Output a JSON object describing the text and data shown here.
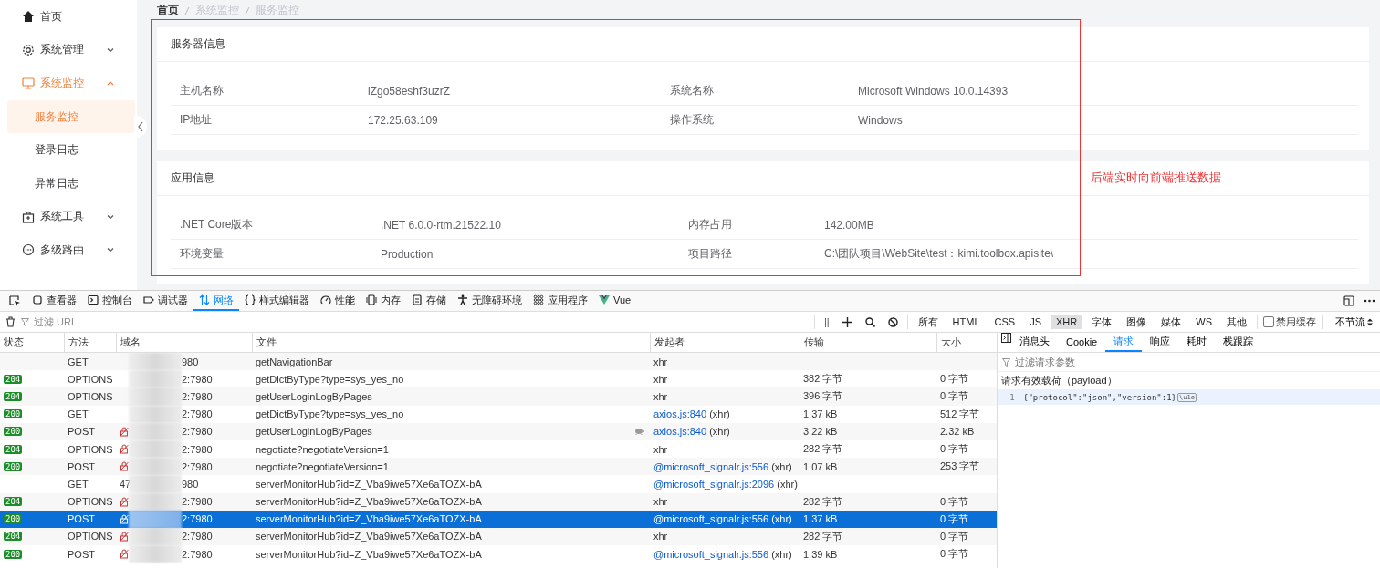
{
  "sidebar": {
    "items": [
      {
        "kind": "link",
        "label": "首页",
        "selected": false
      },
      {
        "kind": "menu",
        "label": "系统管理",
        "selected": false,
        "expanded": false
      },
      {
        "kind": "menu",
        "label": "系统监控",
        "selected": true,
        "expanded": true,
        "children": [
          {
            "label": "服务监控",
            "selected": true
          },
          {
            "label": "登录日志",
            "selected": false
          },
          {
            "label": "异常日志",
            "selected": false
          }
        ]
      },
      {
        "kind": "menu",
        "label": "系统工具",
        "selected": false,
        "expanded": false
      },
      {
        "kind": "menu",
        "label": "多级路由",
        "selected": false,
        "expanded": false
      }
    ]
  },
  "breadcrumb": [
    {
      "label": "首页",
      "link": true
    },
    {
      "label": "系统监控",
      "link": false
    },
    {
      "label": "服务监控",
      "link": false
    }
  ],
  "cards": [
    {
      "title": "服务器信息",
      "rows": [
        [
          "主机名称",
          "iZgo58eshf3uzrZ",
          "系统名称",
          "Microsoft Windows 10.0.14393"
        ],
        [
          "IP地址",
          "172.25.63.109",
          "操作系统",
          "Windows"
        ]
      ]
    },
    {
      "title": "应用信息",
      "rows": [
        [
          ".NET Core版本",
          ".NET 6.0.0-rtm.21522.10",
          "内存占用",
          "142.00MB"
        ],
        [
          "环境变量",
          "Production",
          "项目路径",
          "C:\\团队项目\\WebSite\\test：kimi.toolbox.apisite\\"
        ]
      ]
    }
  ],
  "annotation": {
    "text": "后端实时向前端推送数据"
  },
  "devtools": {
    "tabs": [
      {
        "label": "查看器",
        "selected": false
      },
      {
        "label": "控制台",
        "selected": false
      },
      {
        "label": "调试器",
        "selected": false
      },
      {
        "label": "网络",
        "selected": true
      },
      {
        "label": "样式编辑器",
        "selected": false
      },
      {
        "label": "性能",
        "selected": false
      },
      {
        "label": "内存",
        "selected": false
      },
      {
        "label": "存储",
        "selected": false
      },
      {
        "label": "无障碍环境",
        "selected": false
      },
      {
        "label": "应用程序",
        "selected": false
      },
      {
        "label": "Vue",
        "selected": false
      }
    ],
    "filter": {
      "placeholder": "过滤 URL"
    },
    "pause": "||",
    "type_filters": [
      {
        "label": "所有",
        "selected": false
      },
      {
        "label": "HTML",
        "selected": false
      },
      {
        "label": "CSS",
        "selected": false
      },
      {
        "label": "JS",
        "selected": false
      },
      {
        "label": "XHR",
        "selected": true
      },
      {
        "label": "字体",
        "selected": false
      },
      {
        "label": "图像",
        "selected": false
      },
      {
        "label": "媒体",
        "selected": false
      },
      {
        "label": "WS",
        "selected": false
      },
      {
        "label": "其他",
        "selected": false
      }
    ],
    "disable_cache": {
      "label": "禁用缓存",
      "checked": false
    },
    "throttle": "不节流",
    "columns": [
      "状态",
      "方法",
      "域名",
      "文件",
      "发起者",
      "传输",
      "大小"
    ],
    "requests": [
      {
        "method": "GET",
        "domain_end": "980",
        "insecure": false,
        "file": "getNavigationBar",
        "slow": false,
        "initiator": "xhr",
        "selected": false
      },
      {
        "status": "204",
        "method": "OPTIONS",
        "domain_end": "2:7980",
        "insecure": false,
        "file": "getDictByType?type=sys_yes_no",
        "slow": false,
        "initiator": "xhr",
        "transfer": "382 字节",
        "size": "0 字节",
        "selected": false
      },
      {
        "status": "204",
        "method": "OPTIONS",
        "domain_end": "2:7980",
        "insecure": false,
        "file": "getUserLoginLogByPages",
        "slow": false,
        "initiator": "xhr",
        "transfer": "396 字节",
        "size": "0 字节",
        "selected": false
      },
      {
        "status": "200",
        "method": "GET",
        "domain_end": "2:7980",
        "insecure": false,
        "file": "getDictByType?type=sys_yes_no",
        "slow": false,
        "initiator_link": "axios.js:840",
        "initiator": "(xhr)",
        "transfer": "1.37 kB",
        "size": "512 字节",
        "selected": false
      },
      {
        "status": "200",
        "method": "POST",
        "domain_end": "2:7980",
        "insecure": true,
        "file": "getUserLoginLogByPages",
        "slow": true,
        "initiator_link": "axios.js:840",
        "initiator": "(xhr)",
        "transfer": "3.22 kB",
        "size": "2.32 kB",
        "selected": false
      },
      {
        "status": "204",
        "method": "OPTIONS",
        "domain_end": "2:7980",
        "insecure": true,
        "file": "negotiate?negotiateVersion=1",
        "slow": false,
        "initiator": "xhr",
        "transfer": "282 字节",
        "size": "0 字节",
        "selected": false
      },
      {
        "status": "200",
        "method": "POST",
        "domain_end": "2:7980",
        "insecure": true,
        "file": "negotiate?negotiateVersion=1",
        "slow": false,
        "initiator_link": "@microsoft_signalr.js:556",
        "initiator": "(xhr)",
        "transfer": "1.07 kB",
        "size": "253 字节",
        "selected": false
      },
      {
        "method": "GET",
        "domain_start": "47",
        "domain_end": "980",
        "insecure": false,
        "file": "serverMonitorHub?id=Z_Vba9iwe57Xe6aTOZX-bA",
        "slow": false,
        "initiator_link": "@microsoft_signalr.js:2096",
        "initiator": "(xhr)",
        "selected": false
      },
      {
        "status": "204",
        "method": "OPTIONS",
        "domain_end": "2:7980",
        "insecure": true,
        "file": "serverMonitorHub?id=Z_Vba9iwe57Xe6aTOZX-bA",
        "slow": false,
        "initiator": "xhr",
        "transfer": "282 字节",
        "size": "0 字节",
        "selected": false
      },
      {
        "status": "200",
        "method": "POST",
        "domain_end": "2:7980",
        "insecure": true,
        "file": "serverMonitorHub?id=Z_Vba9iwe57Xe6aTOZX-bA",
        "slow": false,
        "initiator_link": "@microsoft_signalr.js:556",
        "initiator": "(xhr)",
        "transfer": "1.37 kB",
        "size": "0 字节",
        "selected": true
      },
      {
        "status": "204",
        "method": "OPTIONS",
        "domain_end": "2:7980",
        "insecure": true,
        "file": "serverMonitorHub?id=Z_Vba9iwe57Xe6aTOZX-bA",
        "slow": false,
        "initiator": "xhr",
        "transfer": "282 字节",
        "size": "0 字节",
        "selected": false
      },
      {
        "status": "200",
        "method": "POST",
        "domain_end": "2:7980",
        "insecure": true,
        "file": "serverMonitorHub?id=Z_Vba9iwe57Xe6aTOZX-bA",
        "slow": false,
        "initiator_link": "@microsoft_signalr.js:556",
        "initiator": "(xhr)",
        "transfer": "1.39 kB",
        "size": "0 字节",
        "selected": false
      }
    ],
    "detail": {
      "tabs": [
        {
          "label": "消息头",
          "selected": false
        },
        {
          "label": "Cookie",
          "selected": false
        },
        {
          "label": "请求",
          "selected": true
        },
        {
          "label": "响应",
          "selected": false
        },
        {
          "label": "耗时",
          "selected": false
        },
        {
          "label": "栈跟踪",
          "selected": false
        }
      ],
      "filter": {
        "placeholder": "过滤请求参数"
      },
      "section": "请求有效载荷（payload）",
      "lines": [
        {
          "number": "1",
          "code": "{\"protocol\":\"json\",\"version\":1}",
          "tag": "\\u1e"
        }
      ]
    }
  }
}
